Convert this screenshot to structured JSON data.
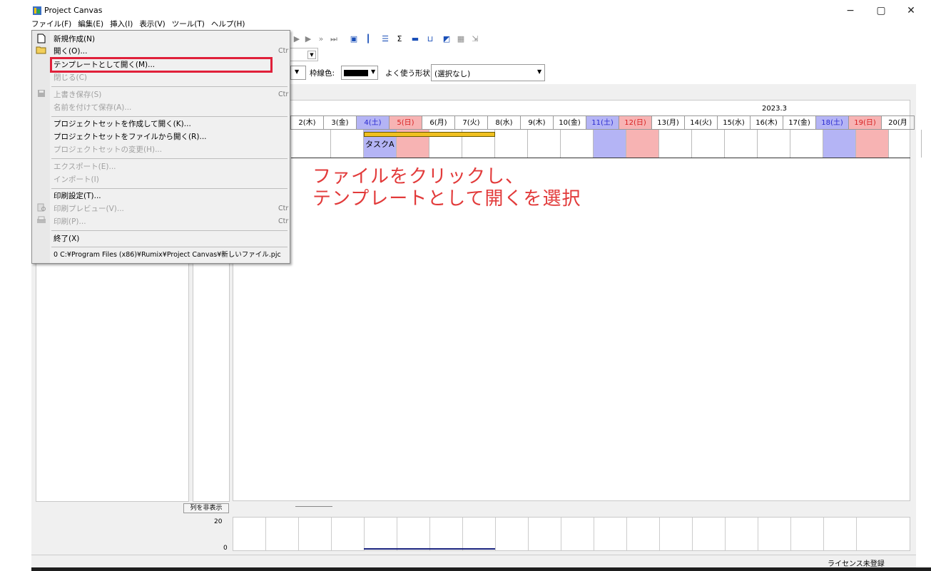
{
  "window": {
    "title": "Project Canvas",
    "controls": {
      "minimize": "−",
      "maximize": "▢",
      "close": "✕"
    }
  },
  "menubar": {
    "items": [
      "ファイル(F)",
      "編集(E)",
      "挿入(I)",
      "表示(V)",
      "ツール(T)",
      "ヘルプ(H)"
    ]
  },
  "toolbar": {
    "border_color_label": "枠線色:",
    "frequent_shape_label": "よく使う形状:",
    "frequent_shape_value": "(選択なし)"
  },
  "gantt": {
    "year_month": "2023.3",
    "dates": [
      {
        "label": "2(木)",
        "kind": "weekday"
      },
      {
        "label": "3(金)",
        "kind": "weekday"
      },
      {
        "label": "4(土)",
        "kind": "sat"
      },
      {
        "label": "5(日)",
        "kind": "sun"
      },
      {
        "label": "6(月)",
        "kind": "weekday"
      },
      {
        "label": "7(火)",
        "kind": "weekday"
      },
      {
        "label": "8(水)",
        "kind": "weekday"
      },
      {
        "label": "9(木)",
        "kind": "weekday"
      },
      {
        "label": "10(金)",
        "kind": "weekday"
      },
      {
        "label": "11(土)",
        "kind": "sat"
      },
      {
        "label": "12(日)",
        "kind": "sun"
      },
      {
        "label": "13(月)",
        "kind": "weekday"
      },
      {
        "label": "14(火)",
        "kind": "weekday"
      },
      {
        "label": "15(水)",
        "kind": "weekday"
      },
      {
        "label": "16(木)",
        "kind": "weekday"
      },
      {
        "label": "17(金)",
        "kind": "weekday"
      },
      {
        "label": "18(土)",
        "kind": "sat"
      },
      {
        "label": "19(日)",
        "kind": "sun"
      },
      {
        "label": "20(月",
        "kind": "weekday"
      }
    ],
    "task_label": "タスクA",
    "task_color": "#f0c020"
  },
  "annotation": {
    "line1": "ファイルをクリックし、",
    "line2": "テンプレートとして開くを選択",
    "color": "#e23a3a"
  },
  "file_menu": {
    "items": [
      {
        "label": "新規作成(N)",
        "enabled": true,
        "icon": "new-file-icon",
        "shortcut": ""
      },
      {
        "label": "開く(O)...",
        "enabled": true,
        "icon": "open-folder-icon",
        "shortcut": "Ctr"
      },
      {
        "label": "テンプレートとして開く(M)...",
        "enabled": true,
        "icon": "",
        "shortcut": ""
      },
      {
        "label": "閉じる(C)",
        "enabled": false,
        "icon": "",
        "shortcut": ""
      },
      {
        "label": "上書き保存(S)",
        "enabled": false,
        "icon": "save-icon",
        "shortcut": "Ctr"
      },
      {
        "label": "名前を付けて保存(A)...",
        "enabled": false,
        "icon": "",
        "shortcut": ""
      },
      {
        "label": "プロジェクトセットを作成して開く(K)...",
        "enabled": true,
        "icon": "",
        "shortcut": ""
      },
      {
        "label": "プロジェクトセットをファイルから開く(R)...",
        "enabled": true,
        "icon": "",
        "shortcut": ""
      },
      {
        "label": "プロジェクトセットの変更(H)...",
        "enabled": false,
        "icon": "",
        "shortcut": ""
      },
      {
        "label": "エクスポート(E)...",
        "enabled": false,
        "icon": "",
        "shortcut": ""
      },
      {
        "label": "インポート(I)",
        "enabled": false,
        "icon": "",
        "shortcut": ""
      },
      {
        "label": "印刷設定(T)...",
        "enabled": true,
        "icon": "",
        "shortcut": ""
      },
      {
        "label": "印刷プレビュー(V)...",
        "enabled": false,
        "icon": "print-preview-icon",
        "shortcut": "Ctr"
      },
      {
        "label": "印刷(P)...",
        "enabled": false,
        "icon": "print-icon",
        "shortcut": "Ctr"
      },
      {
        "label": "終了(X)",
        "enabled": true,
        "icon": "",
        "shortcut": ""
      },
      {
        "label": "0 C:¥Program Files (x86)¥Rumix¥Project Canvas¥新しいファイル.pjc",
        "enabled": true,
        "icon": "",
        "shortcut": ""
      }
    ]
  },
  "bottom": {
    "hide_columns_button": "列を非表示",
    "y_max": "20",
    "y_min": "0"
  },
  "status": {
    "license": "ライセンス未登録"
  }
}
